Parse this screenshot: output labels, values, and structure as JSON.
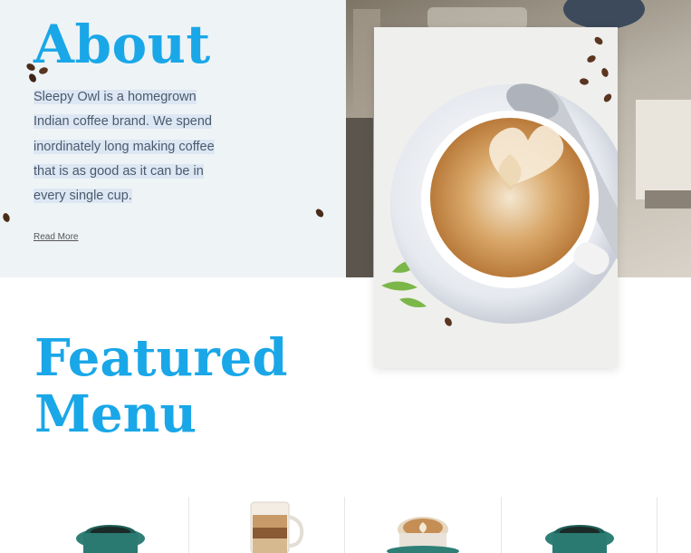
{
  "about": {
    "title": "About",
    "lines": [
      "Sleepy Owl is a homegrown",
      "Indian coffee brand. We spend",
      "inordinately long making coffee",
      "that is as good as it can be in",
      "every single cup."
    ],
    "read_more": "Read More"
  },
  "featured": {
    "title_line1": "Featured",
    "title_line2": "Menu"
  },
  "menu_items": [
    {
      "icon": "teal-coffee-cup-icon"
    },
    {
      "icon": "layered-latte-glass-icon"
    },
    {
      "icon": "latte-art-cup-icon"
    },
    {
      "icon": "teal-coffee-cup-icon"
    }
  ],
  "colors": {
    "accent": "#1aa7e8",
    "about_bg": "#eef3f6",
    "body_text": "#4a5a6e"
  }
}
